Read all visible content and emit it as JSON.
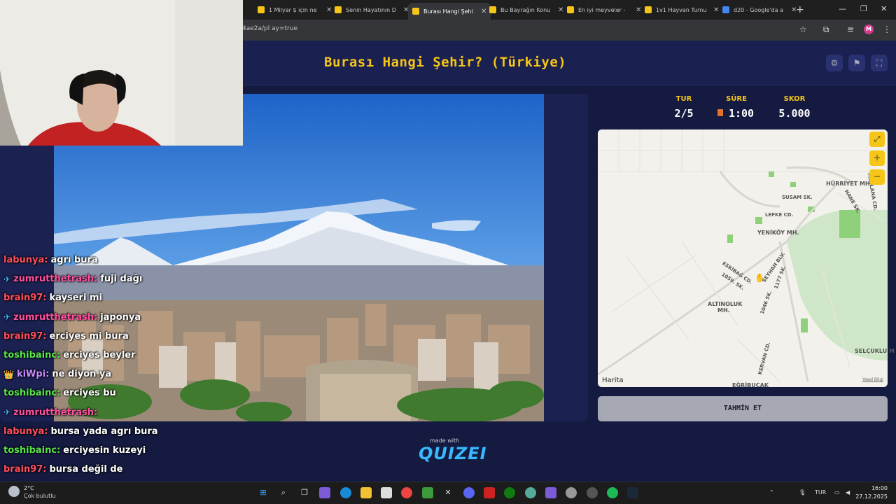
{
  "browser": {
    "tabs": [
      {
        "title": "1 Milyar $ için ne",
        "color": "#f5c518"
      },
      {
        "title": "Senin Hayatının D",
        "color": "#f5c518"
      },
      {
        "title": "Burası Hangi Şehi",
        "color": "#f5c518"
      },
      {
        "title": "Bu Bayrağın Konu",
        "color": "#f5c518"
      },
      {
        "title": "En iyi meyveler -",
        "color": "#f5c518"
      },
      {
        "title": "1v1 Hayvan Turnu",
        "color": "#f5c518"
      },
      {
        "title": "d20 - Google'da a",
        "color": "#4285f4"
      }
    ],
    "url": "4ae2a/pl              ay=true",
    "profile_initial": "M"
  },
  "app": {
    "title": "Burası Hangi Şehir? (Türkiye)",
    "icons": [
      "settings-icon",
      "flag-icon",
      "fullscreen-icon"
    ]
  },
  "stats": {
    "round_label": "TUR",
    "round_value": "2/5",
    "time_label": "SÜRE",
    "time_value": "1:00",
    "score_label": "SKOR",
    "score_value": "5.000"
  },
  "map": {
    "labels": {
      "hurriyet": "HÜRRİYET MH.",
      "susam": "SUSAM SK.",
      "lefke": "LEFKE CD.",
      "yenikoy": "YENİKÖY MH.",
      "seyhan": "SEYHAN BLV.",
      "eskibag": "ESKİBAĞ CD.",
      "sk1059": "1059. SK.",
      "sk1177": "1177 SK.",
      "altinoluk": "ALTINOLUK",
      "altinoluk_mh": "MH.",
      "sk1046": "1046 SK.",
      "selcuklu": "SELÇUKLU M",
      "egribucak": "EĞRİBUCAK",
      "kervan": "KERVAN CD.",
      "mevlana": "MEVLANA CD.",
      "hane": "HANE SK."
    },
    "attribution": "Harita",
    "legal": "Yasal Bilgi"
  },
  "guess_button": "TAHMİN ET",
  "footer": {
    "made_with": "made with",
    "brand": "QUIZEI"
  },
  "chat": [
    {
      "name": "labunya:",
      "color": "#ff4f5e",
      "badge": "",
      "text": "agrı bura"
    },
    {
      "name": "zumrutthetrash:",
      "color": "#ff4fa0",
      "badge": "✈",
      "text": "fuji dağı"
    },
    {
      "name": "brain97:",
      "color": "#ff4f5e",
      "badge": "",
      "text": "kayseri mi"
    },
    {
      "name": "zumrutthetrash:",
      "color": "#ff4fa0",
      "badge": "✈",
      "text": "japonya"
    },
    {
      "name": "brain97:",
      "color": "#ff4f5e",
      "badge": "",
      "text": "erciyes mi bura"
    },
    {
      "name": "toshibainc:",
      "color": "#57e64a",
      "badge": "",
      "text": "erciyes beyler"
    },
    {
      "name": "kiWpi:",
      "color": "#c88cff",
      "badge": "👑",
      "text": "ne diyon ya"
    },
    {
      "name": "toshibainc:",
      "color": "#57e64a",
      "badge": "",
      "text": "erciyes bu"
    },
    {
      "name": "zumrutthetrash:",
      "color": "#ff4fa0",
      "badge": "✈",
      "text": ""
    },
    {
      "name": "labunya:",
      "color": "#ff4f5e",
      "badge": "",
      "text": "bursa yada agrı bura"
    },
    {
      "name": "toshibainc:",
      "color": "#57e64a",
      "badge": "",
      "text": "erciyesin kuzeyi"
    },
    {
      "name": "brain97:",
      "color": "#ff4f5e",
      "badge": "",
      "text": "bursa değil de"
    }
  ],
  "taskbar": {
    "weather_temp": "2°C",
    "weather_desc": "Çok bulutlu",
    "lang": "TUR",
    "time": "16:00",
    "date": "27.12.2025"
  }
}
